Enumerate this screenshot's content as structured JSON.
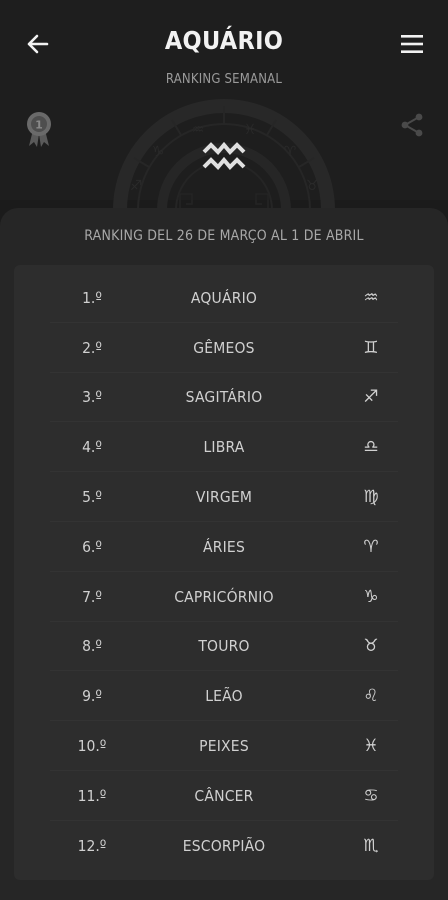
{
  "header": {
    "title": "AQUÁRIO",
    "subtitle": "RANKING SEMANAL"
  },
  "card": {
    "caption": "RANKING DEL 26 DE MARÇO AL 1 DE ABRIL"
  },
  "colors": {
    "background": "#1b1b1b",
    "card": "#262626",
    "table": "#2d2d2d",
    "text": "#d0d0d0",
    "muted": "#9a9a9a"
  },
  "icons": {
    "back": "arrow-left-icon",
    "menu": "hamburger-menu-icon",
    "medal": "award-ribbon-icon",
    "share": "share-icon",
    "emblem": "aquarius-icon"
  },
  "ranking": [
    {
      "position": "1.º",
      "sign": "AQUÁRIO",
      "glyph": "♒"
    },
    {
      "position": "2.º",
      "sign": "GÊMEOS",
      "glyph": "♊"
    },
    {
      "position": "3.º",
      "sign": "SAGITÁRIO",
      "glyph": "♐"
    },
    {
      "position": "4.º",
      "sign": "LIBRA",
      "glyph": "♎"
    },
    {
      "position": "5.º",
      "sign": "VIRGEM",
      "glyph": "♍"
    },
    {
      "position": "6.º",
      "sign": "ÁRIES",
      "glyph": "♈"
    },
    {
      "position": "7.º",
      "sign": "CAPRICÓRNIO",
      "glyph": "♑"
    },
    {
      "position": "8.º",
      "sign": "TOURO",
      "glyph": "♉"
    },
    {
      "position": "9.º",
      "sign": "LEÃO",
      "glyph": "♌"
    },
    {
      "position": "10.º",
      "sign": "PEIXES",
      "glyph": "♓"
    },
    {
      "position": "11.º",
      "sign": "CÂNCER",
      "glyph": "♋"
    },
    {
      "position": "12.º",
      "sign": "ESCORPIÃO",
      "glyph": "♏"
    }
  ]
}
